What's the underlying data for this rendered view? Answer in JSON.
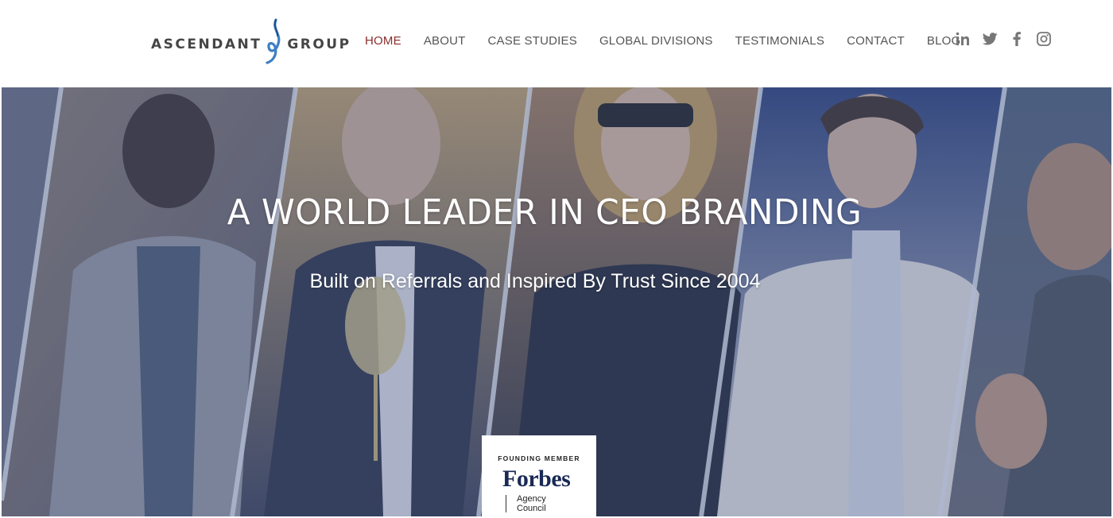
{
  "header": {
    "logo": {
      "text_left": "ASCENDANT",
      "text_right": "GROUP",
      "mark_color": "#3d7fc2"
    },
    "nav": [
      {
        "label": "HOME",
        "active": true
      },
      {
        "label": "ABOUT"
      },
      {
        "label": "CASE STUDIES"
      },
      {
        "label": "GLOBAL DIVISIONS"
      },
      {
        "label": "TESTIMONIALS"
      },
      {
        "label": "CONTACT"
      },
      {
        "label": "BLOG"
      }
    ],
    "social": [
      "linkedin-icon",
      "twitter-icon",
      "facebook-icon",
      "instagram-icon"
    ],
    "active_color": "#8a2d2d",
    "icon_color": "#777777"
  },
  "hero": {
    "title": "A WORLD LEADER IN CEO BRANDING",
    "subtitle": "Built on Referrals and Inspired By Trust Since 2004",
    "overlay_color": "#465c8c"
  },
  "badge": {
    "label": "FOUNDING MEMBER",
    "brand": "Forbes",
    "sub_line1": "Agency",
    "sub_line2": "Council"
  }
}
